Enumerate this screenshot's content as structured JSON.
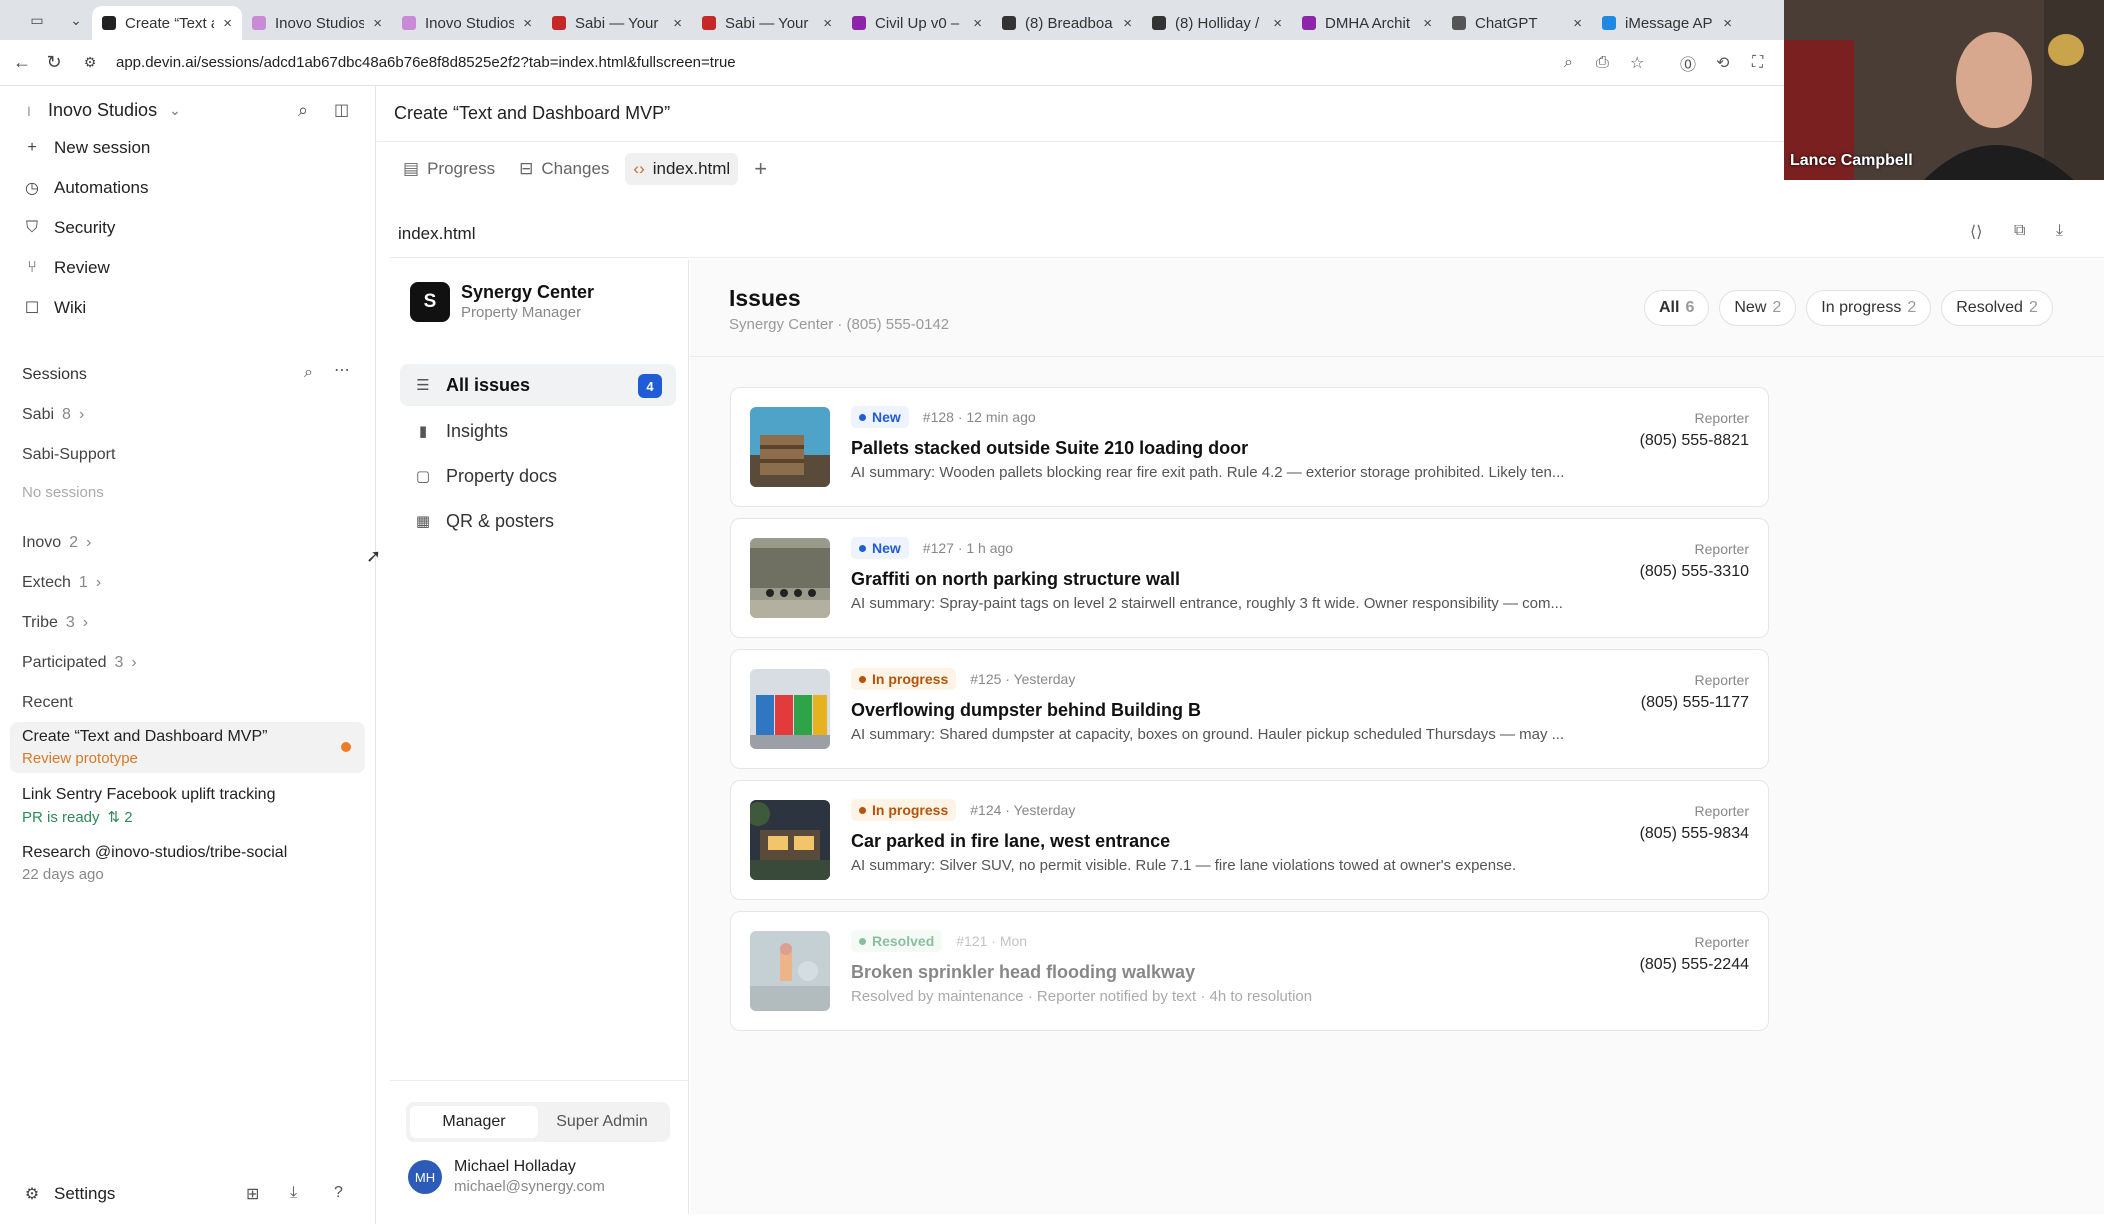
{
  "browser": {
    "tabs": [
      {
        "title": "Create “Text a",
        "fav": "#222",
        "active": true
      },
      {
        "title": "Inovo Studios",
        "fav": "#c98bd6"
      },
      {
        "title": "Inovo Studios",
        "fav": "#c98bd6"
      },
      {
        "title": "Sabi — Your ·",
        "fav": "#c62828"
      },
      {
        "title": "Sabi — Your ·",
        "fav": "#c62828"
      },
      {
        "title": "Civil Up v0 –",
        "fav": "#8e24aa"
      },
      {
        "title": "(8) Breadboa",
        "fav": "#333"
      },
      {
        "title": "(8) Holliday /",
        "fav": "#333"
      },
      {
        "title": "DMHA Archit",
        "fav": "#8e24aa"
      },
      {
        "title": "ChatGPT",
        "fav": "#555"
      },
      {
        "title": "iMessage AP",
        "fav": "#1e88e5"
      }
    ],
    "url": "app.devin.ai/sessions/adcd1ab67dbc48a6b76e8f8d8525e2f2?tab=index.html&fullscreen=true"
  },
  "sidebar": {
    "workspace": "Inovo Studios",
    "workspace_initial": "I",
    "menu": [
      {
        "label": "New session",
        "icon": "+"
      },
      {
        "label": "Automations",
        "icon": "◷"
      },
      {
        "label": "Security",
        "icon": "⛉"
      },
      {
        "label": "Review",
        "icon": "⑂"
      },
      {
        "label": "Wiki",
        "icon": "☐"
      }
    ],
    "sessions_label": "Sessions",
    "groups": [
      {
        "name": "Sabi",
        "count": "8",
        "chevron": "›"
      },
      {
        "name": "Sabi-Support",
        "count": "",
        "chevron": ""
      }
    ],
    "no_sessions": "No sessions",
    "groups2": [
      {
        "name": "Inovo",
        "count": "2"
      },
      {
        "name": "Extech",
        "count": "1"
      },
      {
        "name": "Tribe",
        "count": "3"
      },
      {
        "name": "Participated",
        "count": "3"
      }
    ],
    "recent_label": "Recent",
    "recent": [
      {
        "title": "Create “Text and Dashboard MVP”",
        "sub": "Review prototype"
      },
      {
        "title": "Link Sentry Facebook uplift tracking",
        "sub": "PR is ready",
        "sub2": "⇅ 2"
      },
      {
        "title": "Research @inovo-studios/tribe-social",
        "sub": "22 days ago"
      }
    ],
    "settings": "Settings"
  },
  "main": {
    "title": "Create “Text and Dashboard MVP”",
    "tabs": [
      "Progress",
      "Changes",
      "index.html"
    ],
    "file": "index.html"
  },
  "app": {
    "org": "Synergy Center",
    "org_initial": "S",
    "role": "Property Manager",
    "nav": [
      {
        "label": "All issues",
        "icon": "☰",
        "badge": "4"
      },
      {
        "label": "Insights",
        "icon": "▮"
      },
      {
        "label": "Property docs",
        "icon": "▢"
      },
      {
        "label": "QR & posters",
        "icon": "▦"
      }
    ],
    "roles": [
      "Manager",
      "Super Admin"
    ],
    "user_name": "Michael Holladay",
    "user_email": "michael@synergy.com",
    "user_initials": "MH"
  },
  "issues": {
    "title": "Issues",
    "subtitle": "Synergy Center · (805) 555-0142",
    "filters": [
      {
        "label": "All",
        "count": "6"
      },
      {
        "label": "New",
        "count": "2"
      },
      {
        "label": "In progress",
        "count": "2"
      },
      {
        "label": "Resolved",
        "count": "2"
      }
    ],
    "reporter_label": "Reporter",
    "list": [
      {
        "status": "New",
        "status_color": "#1f5cd6",
        "status_bg": "#eef3fd",
        "meta": "#128 · 12 min ago",
        "title": "Pallets stacked outside Suite 210 loading door",
        "summary": "AI summary: Wooden pallets blocking rear fire exit path. Rule 4.2 — exterior storage prohibited. Likely ten...",
        "phone": "(805) 555-8821"
      },
      {
        "status": "New",
        "status_color": "#1f5cd6",
        "status_bg": "#eef3fd",
        "meta": "#127 · 1 h ago",
        "title": "Graffiti on north parking structure wall",
        "summary": "AI summary: Spray-paint tags on level 2 stairwell entrance, roughly 3 ft wide. Owner responsibility — com...",
        "phone": "(805) 555-3310"
      },
      {
        "status": "In progress",
        "status_color": "#b45309",
        "status_bg": "#fdf4e6",
        "meta": "#125 · Yesterday",
        "title": "Overflowing dumpster behind Building B",
        "summary": "AI summary: Shared dumpster at capacity, boxes on ground. Hauler pickup scheduled Thursdays — may ...",
        "phone": "(805) 555-1177"
      },
      {
        "status": "In progress",
        "status_color": "#b45309",
        "status_bg": "#fdf4e6",
        "meta": "#124 · Yesterday",
        "title": "Car parked in fire lane, west entrance",
        "summary": "AI summary: Silver SUV, no permit visible. Rule 7.1 — fire lane violations towed at owner's expense.",
        "phone": "(805) 555-9834"
      },
      {
        "status": "Resolved",
        "status_color": "#15803d",
        "status_bg": "#ecf7ef",
        "meta": "#121 · Mon",
        "title": "Broken sprinkler head flooding walkway",
        "summary": "Resolved by maintenance · Reporter notified by text · 4h to resolution",
        "phone": "(805) 555-2244"
      }
    ]
  },
  "video": {
    "name": "Lance Campbell"
  }
}
